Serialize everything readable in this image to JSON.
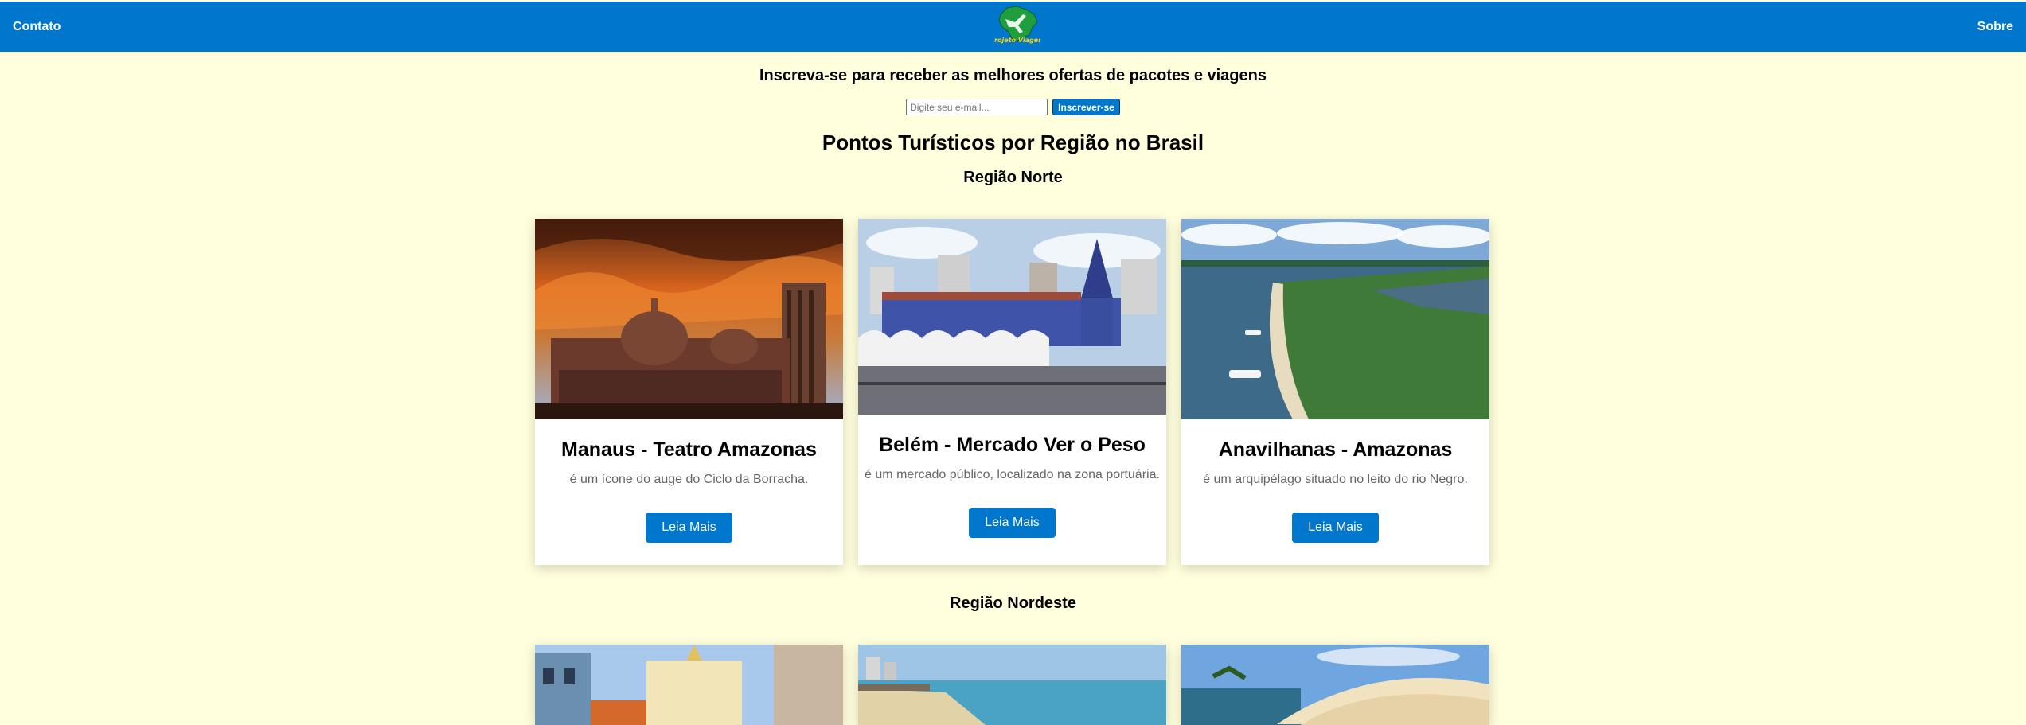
{
  "nav": {
    "left_link": "Contato",
    "right_link": "Sobre",
    "logo_text": "Projeto Viagem"
  },
  "subscribe": {
    "title": "Inscreva-se para receber as melhores ofertas de pacotes e viagens",
    "placeholder": "Digite seu e-mail...",
    "button": "Inscrever-se"
  },
  "main_title": "Pontos Turísticos por Região no Brasil",
  "regions": [
    {
      "title": "Região Norte",
      "cards": [
        {
          "title": "Manaus - Teatro Amazonas",
          "description": "é um ícone do auge do Ciclo da Borracha.",
          "button": "Leia Mais"
        },
        {
          "title": "Belém - Mercado Ver o Peso",
          "description": "é um mercado público, localizado na zona portuária.",
          "button": "Leia Mais"
        },
        {
          "title": "Anavilhanas - Amazonas",
          "description": "é um arquipélago situado no leito do rio Negro.",
          "button": "Leia Mais"
        }
      ]
    },
    {
      "title": "Região Nordeste",
      "cards": []
    }
  ],
  "colors": {
    "nav_blue": "#0077cc",
    "page_bg": "#ffffdd"
  }
}
